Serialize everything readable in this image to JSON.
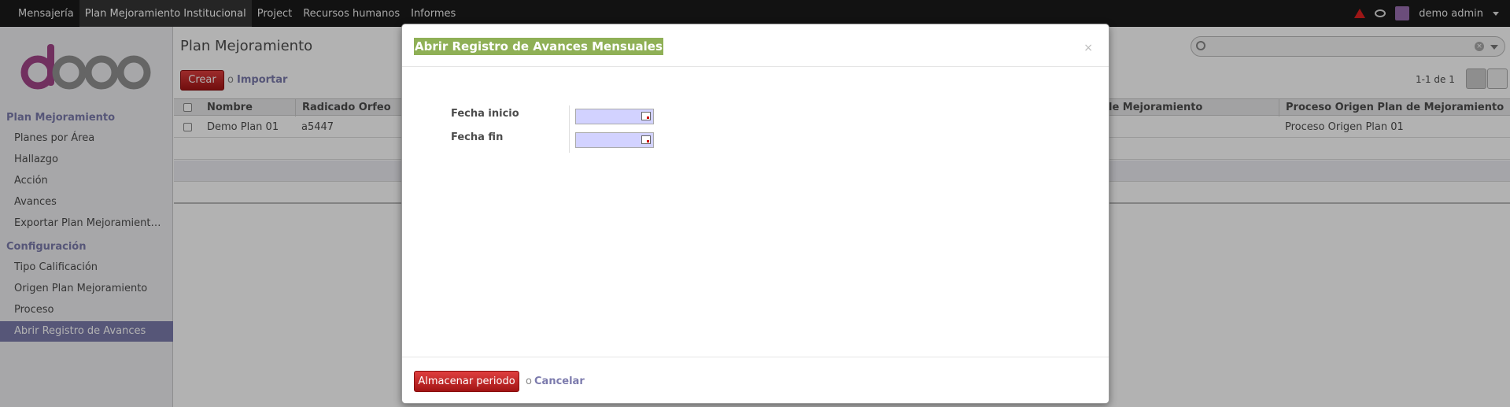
{
  "topbar": {
    "menu": [
      {
        "label": "Mensajería",
        "active": false
      },
      {
        "label": "Plan Mejoramiento Institucional",
        "active": true
      },
      {
        "label": "Project",
        "active": false
      },
      {
        "label": "Recursos humanos",
        "active": false
      },
      {
        "label": "Informes",
        "active": false
      }
    ],
    "user": "demo admin"
  },
  "sidebar": {
    "section1": "Plan Mejoramiento",
    "items1": [
      "Planes por Área",
      "Hallazgo",
      "Acción",
      "Avances",
      "Exportar Plan Mejoramient…"
    ],
    "section2": "Configuración",
    "items2": [
      "Tipo Calificación",
      "Origen Plan Mejoramiento",
      "Proceso",
      "Abrir Registro de Avances"
    ]
  },
  "main": {
    "title": "Plan Mejoramiento",
    "create_label": "Crear",
    "or": "o",
    "import_label": "Importar",
    "pager": "1-1 de 1",
    "columns": [
      "Nombre",
      "Radicado Orfeo",
      "le Mejoramiento",
      "Proceso Origen Plan de Mejoramiento"
    ],
    "rows": [
      [
        "Demo Plan 01",
        "a5447",
        "",
        "Proceso Origen Plan 01"
      ]
    ]
  },
  "modal": {
    "title": "Abrir Registro de Avances Mensuales",
    "close": "×",
    "fields": [
      {
        "label": "Fecha inicio",
        "value": ""
      },
      {
        "label": "Fecha fin",
        "value": ""
      }
    ],
    "save_label": "Almacenar periodo",
    "or": "o",
    "cancel_label": "Cancelar"
  },
  "colors": {
    "topbar": "#1a1a1a",
    "accent": "#7c7bad",
    "primary_button": "#b92222",
    "title_highlight": "#8fb056",
    "date_input": "#d2d2ff"
  }
}
